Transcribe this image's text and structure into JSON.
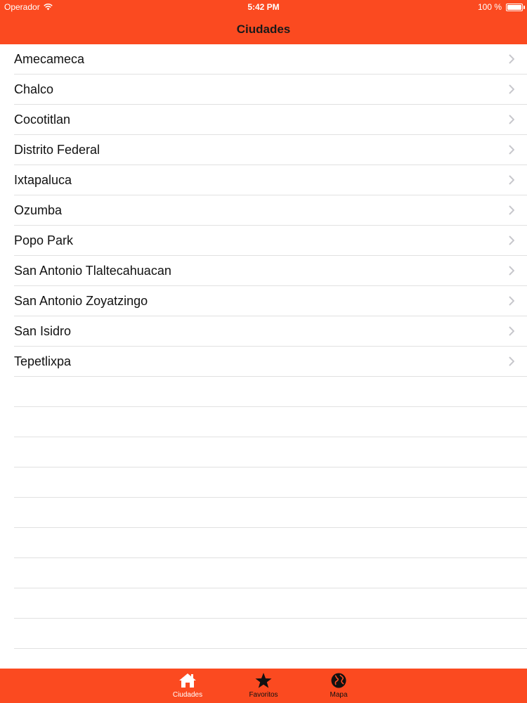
{
  "status_bar": {
    "carrier": "Operador",
    "time": "5:42 PM",
    "battery": "100 %"
  },
  "nav_bar": {
    "title": "Ciudades"
  },
  "cities": [
    "Amecameca",
    "Chalco",
    "Cocotitlan",
    "Distrito Federal",
    "Ixtapaluca",
    "Ozumba",
    "Popo Park",
    "San Antonio Tlaltecahuacan",
    "San Antonio Zoyatzingo",
    "San Isidro",
    "Tepetlixpa"
  ],
  "tab_bar": {
    "tabs": [
      {
        "label": "Ciudades",
        "icon": "home-icon",
        "active": true
      },
      {
        "label": "Favoritos",
        "icon": "star-icon",
        "active": false
      },
      {
        "label": "Mapa",
        "icon": "globe-icon",
        "active": false
      }
    ]
  },
  "colors": {
    "accent": "#fb4a20",
    "separator": "#e1e1e1",
    "chevron": "#c7c7cc"
  }
}
